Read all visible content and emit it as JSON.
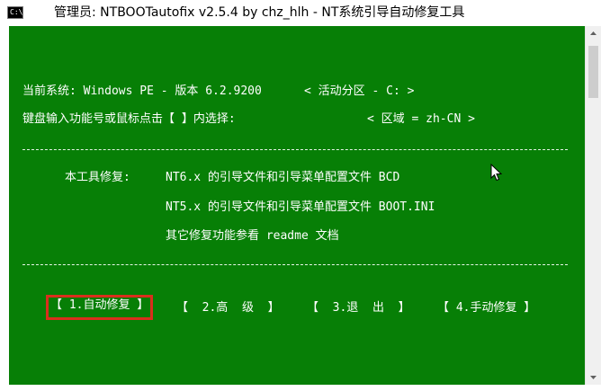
{
  "window": {
    "title": "管理员:  NTBOOTautofix v2.5.4 by chz_hlh - NT系统引导自动修复工具",
    "icon": "console-app-icon"
  },
  "status": {
    "current_system": "当前系统: Windows PE - 版本 6.2.9200",
    "active_partition": "< 活动分区 - C: >",
    "prompt": "键盘输入功能号或鼠标点击【 】内选择:",
    "locale": "< 区域 = zh-CN >"
  },
  "info": {
    "intro_label": "本工具修复:",
    "line1": "NT6.x 的引导文件和引导菜单配置文件 BCD",
    "line2": "NT5.x 的引导文件和引导菜单配置文件 BOOT.INI",
    "line3": "其它修复功能参看 readme 文档"
  },
  "menu": {
    "items": [
      {
        "label": "【 1.自动修复 】",
        "selected": true
      },
      {
        "label": "【  2.高  级  】",
        "selected": false
      },
      {
        "label": "【  3.退  出  】",
        "selected": false
      },
      {
        "label": "【 4.手动修复 】",
        "selected": false
      }
    ]
  },
  "colors": {
    "console_bg": "#077f06",
    "text": "#ffffff",
    "selection_border": "#d92f1c"
  }
}
